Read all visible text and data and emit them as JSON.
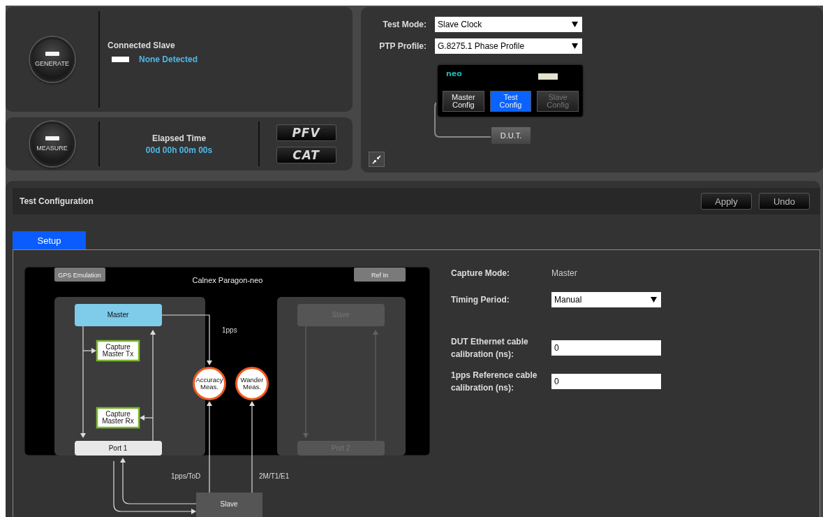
{
  "generate": {
    "label": "GENERATE"
  },
  "connected_slave": {
    "title": "Connected Slave",
    "status": "None Detected"
  },
  "measure": {
    "label": "MEASURE"
  },
  "elapsed": {
    "title": "Elapsed Time",
    "value": "00d 00h 00m 00s"
  },
  "mode_buttons": [
    "PFV",
    "CAT"
  ],
  "test_mode": {
    "label": "Test Mode:",
    "value": "Slave Clock"
  },
  "ptp_profile": {
    "label": "PTP Profile:",
    "value": "G.8275.1 Phase Profile"
  },
  "device": {
    "brand": "neo",
    "buttons": [
      {
        "label": "Master\nConfig",
        "selected": false,
        "disabled": false
      },
      {
        "label": "Test\nConfig",
        "selected": true,
        "disabled": false
      },
      {
        "label": "Slave\nConfig",
        "selected": false,
        "disabled": true
      }
    ],
    "dut": "D.U.T."
  },
  "panel": {
    "title": "Test Configuration",
    "buttons": [
      "Apply",
      "Undo"
    ]
  },
  "tabs": [
    {
      "label": "Setup",
      "selected": true
    }
  ],
  "diagram": {
    "title": "Calnex Paragon-neo",
    "inputs": [
      {
        "label": "GPS Emulation",
        "disabled": true
      },
      {
        "label": "Ref In",
        "disabled": true
      }
    ],
    "master": {
      "label": "Master",
      "disabled": false
    },
    "slave": {
      "label": "Slave",
      "disabled": true
    },
    "port_1": {
      "label": "Port 1",
      "disabled": false
    },
    "port_2": {
      "label": "Port 2",
      "disabled": true
    },
    "captures": [
      "Capture\nMaster Tx",
      "Capture\nMaster Rx"
    ],
    "measurements": [
      "Accuracy\nMeas.",
      "Wander\nMeas."
    ],
    "signals": [
      "1pps",
      "1pps/ToD",
      "2M/T1/E1"
    ],
    "external": "Slave"
  },
  "form": {
    "capture_mode": {
      "label": "Capture Mode:",
      "value": "Master"
    },
    "timing_period": {
      "label": "Timing Period:",
      "value": "Manual"
    },
    "dut_calibration": {
      "label": "DUT Ethernet cable\ncalibration (ns):",
      "value": "0"
    },
    "pps_calibration": {
      "label": "1pps Reference cable\ncalibration (ns):",
      "value": "0"
    }
  }
}
